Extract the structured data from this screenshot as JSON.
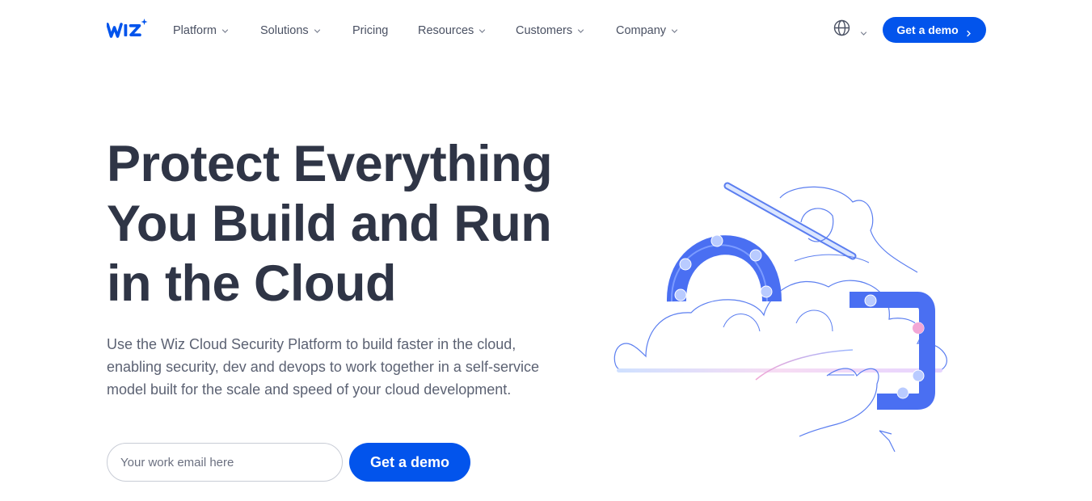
{
  "brand": {
    "logo_text": "WIZ",
    "accent_color": "#0254ec",
    "text_color": "#2f3546"
  },
  "nav": {
    "items": [
      {
        "label": "Platform",
        "has_dropdown": true
      },
      {
        "label": "Solutions",
        "has_dropdown": true
      },
      {
        "label": "Pricing",
        "has_dropdown": false
      },
      {
        "label": "Resources",
        "has_dropdown": true
      },
      {
        "label": "Customers",
        "has_dropdown": true
      },
      {
        "label": "Company",
        "has_dropdown": true
      }
    ],
    "language_icon": "globe-icon",
    "cta_label": "Get a demo",
    "cta_icon": "chevron-right-icon"
  },
  "hero": {
    "title_lines": [
      "Protect Everything",
      "You Build and Run",
      "in the Cloud"
    ],
    "subtitle": "Use the Wiz Cloud Security Platform to build faster in the cloud, enabling security, dev and devops to work together in a self-service model built for the scale and speed of your cloud development.",
    "email_placeholder": "Your work email here",
    "email_value": "",
    "cta_label": "Get a demo",
    "illustration": "cloud-security-illustration"
  }
}
